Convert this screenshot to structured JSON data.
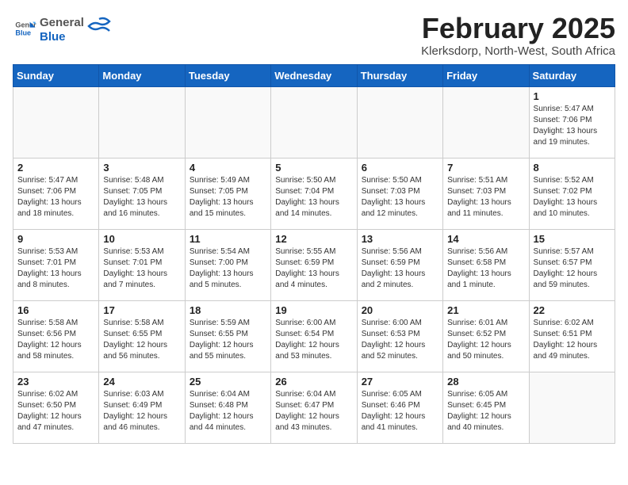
{
  "header": {
    "logo_general": "General",
    "logo_blue": "Blue",
    "month_title": "February 2025",
    "location": "Klerksdorp, North-West, South Africa"
  },
  "weekdays": [
    "Sunday",
    "Monday",
    "Tuesday",
    "Wednesday",
    "Thursday",
    "Friday",
    "Saturday"
  ],
  "weeks": [
    [
      {
        "day": "",
        "info": ""
      },
      {
        "day": "",
        "info": ""
      },
      {
        "day": "",
        "info": ""
      },
      {
        "day": "",
        "info": ""
      },
      {
        "day": "",
        "info": ""
      },
      {
        "day": "",
        "info": ""
      },
      {
        "day": "1",
        "info": "Sunrise: 5:47 AM\nSunset: 7:06 PM\nDaylight: 13 hours\nand 19 minutes."
      }
    ],
    [
      {
        "day": "2",
        "info": "Sunrise: 5:47 AM\nSunset: 7:06 PM\nDaylight: 13 hours\nand 18 minutes."
      },
      {
        "day": "3",
        "info": "Sunrise: 5:48 AM\nSunset: 7:05 PM\nDaylight: 13 hours\nand 16 minutes."
      },
      {
        "day": "4",
        "info": "Sunrise: 5:49 AM\nSunset: 7:05 PM\nDaylight: 13 hours\nand 15 minutes."
      },
      {
        "day": "5",
        "info": "Sunrise: 5:50 AM\nSunset: 7:04 PM\nDaylight: 13 hours\nand 14 minutes."
      },
      {
        "day": "6",
        "info": "Sunrise: 5:50 AM\nSunset: 7:03 PM\nDaylight: 13 hours\nand 12 minutes."
      },
      {
        "day": "7",
        "info": "Sunrise: 5:51 AM\nSunset: 7:03 PM\nDaylight: 13 hours\nand 11 minutes."
      },
      {
        "day": "8",
        "info": "Sunrise: 5:52 AM\nSunset: 7:02 PM\nDaylight: 13 hours\nand 10 minutes."
      }
    ],
    [
      {
        "day": "9",
        "info": "Sunrise: 5:53 AM\nSunset: 7:01 PM\nDaylight: 13 hours\nand 8 minutes."
      },
      {
        "day": "10",
        "info": "Sunrise: 5:53 AM\nSunset: 7:01 PM\nDaylight: 13 hours\nand 7 minutes."
      },
      {
        "day": "11",
        "info": "Sunrise: 5:54 AM\nSunset: 7:00 PM\nDaylight: 13 hours\nand 5 minutes."
      },
      {
        "day": "12",
        "info": "Sunrise: 5:55 AM\nSunset: 6:59 PM\nDaylight: 13 hours\nand 4 minutes."
      },
      {
        "day": "13",
        "info": "Sunrise: 5:56 AM\nSunset: 6:59 PM\nDaylight: 13 hours\nand 2 minutes."
      },
      {
        "day": "14",
        "info": "Sunrise: 5:56 AM\nSunset: 6:58 PM\nDaylight: 13 hours\nand 1 minute."
      },
      {
        "day": "15",
        "info": "Sunrise: 5:57 AM\nSunset: 6:57 PM\nDaylight: 12 hours\nand 59 minutes."
      }
    ],
    [
      {
        "day": "16",
        "info": "Sunrise: 5:58 AM\nSunset: 6:56 PM\nDaylight: 12 hours\nand 58 minutes."
      },
      {
        "day": "17",
        "info": "Sunrise: 5:58 AM\nSunset: 6:55 PM\nDaylight: 12 hours\nand 56 minutes."
      },
      {
        "day": "18",
        "info": "Sunrise: 5:59 AM\nSunset: 6:55 PM\nDaylight: 12 hours\nand 55 minutes."
      },
      {
        "day": "19",
        "info": "Sunrise: 6:00 AM\nSunset: 6:54 PM\nDaylight: 12 hours\nand 53 minutes."
      },
      {
        "day": "20",
        "info": "Sunrise: 6:00 AM\nSunset: 6:53 PM\nDaylight: 12 hours\nand 52 minutes."
      },
      {
        "day": "21",
        "info": "Sunrise: 6:01 AM\nSunset: 6:52 PM\nDaylight: 12 hours\nand 50 minutes."
      },
      {
        "day": "22",
        "info": "Sunrise: 6:02 AM\nSunset: 6:51 PM\nDaylight: 12 hours\nand 49 minutes."
      }
    ],
    [
      {
        "day": "23",
        "info": "Sunrise: 6:02 AM\nSunset: 6:50 PM\nDaylight: 12 hours\nand 47 minutes."
      },
      {
        "day": "24",
        "info": "Sunrise: 6:03 AM\nSunset: 6:49 PM\nDaylight: 12 hours\nand 46 minutes."
      },
      {
        "day": "25",
        "info": "Sunrise: 6:04 AM\nSunset: 6:48 PM\nDaylight: 12 hours\nand 44 minutes."
      },
      {
        "day": "26",
        "info": "Sunrise: 6:04 AM\nSunset: 6:47 PM\nDaylight: 12 hours\nand 43 minutes."
      },
      {
        "day": "27",
        "info": "Sunrise: 6:05 AM\nSunset: 6:46 PM\nDaylight: 12 hours\nand 41 minutes."
      },
      {
        "day": "28",
        "info": "Sunrise: 6:05 AM\nSunset: 6:45 PM\nDaylight: 12 hours\nand 40 minutes."
      },
      {
        "day": "",
        "info": ""
      }
    ]
  ]
}
